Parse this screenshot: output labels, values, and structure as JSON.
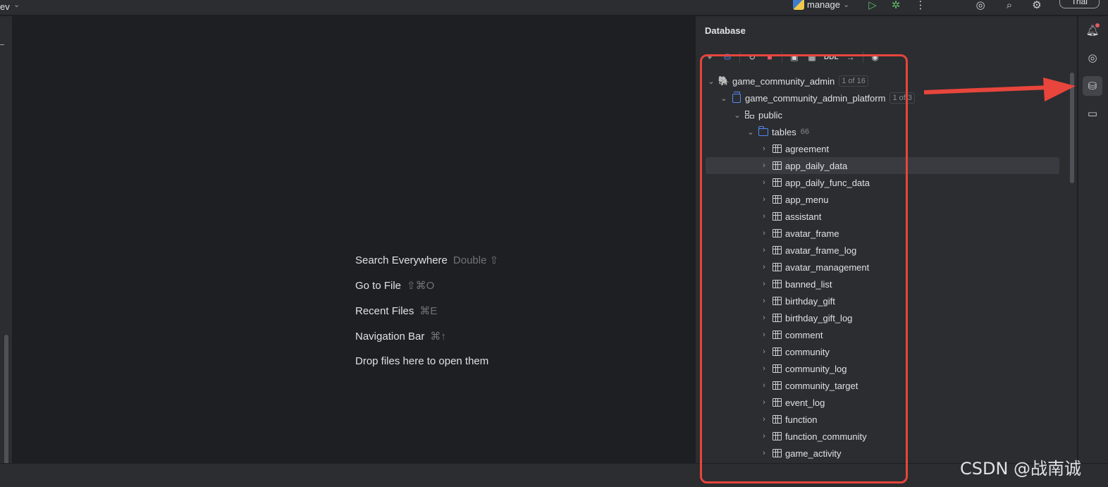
{
  "topbar": {
    "project_fragment": "ev",
    "run_config_label": "manage",
    "trial_label": "Trial",
    "icons": [
      "run-icon",
      "debug-icon",
      "more-icon",
      "ai-assistant-icon",
      "search-icon",
      "settings-icon"
    ]
  },
  "editor": {
    "hints": [
      {
        "label": "Search Everywhere",
        "shortcut": "Double ⇧"
      },
      {
        "label": "Go to File",
        "shortcut": "⇧⌘O"
      },
      {
        "label": "Recent Files",
        "shortcut": "⌘E"
      },
      {
        "label": "Navigation Bar",
        "shortcut": "⌘↑"
      },
      {
        "label": "Drop files here to open them",
        "shortcut": ""
      }
    ]
  },
  "database": {
    "title": "Database",
    "toolbar": {
      "ddl_label": "DDL"
    },
    "tree": {
      "datasource": {
        "name": "game_community_admin",
        "badge": "1 of 16"
      },
      "database": {
        "name": "game_community_admin_platform",
        "badge": "1 of 3"
      },
      "schema": {
        "name": "public"
      },
      "tables_folder": {
        "name": "tables",
        "count": "66"
      },
      "tables": [
        "agreement",
        "app_daily_data",
        "app_daily_func_data",
        "app_menu",
        "assistant",
        "avatar_frame",
        "avatar_frame_log",
        "avatar_management",
        "banned_list",
        "birthday_gift",
        "birthday_gift_log",
        "comment",
        "community",
        "community_log",
        "community_target",
        "event_log",
        "function",
        "function_community",
        "game_activity"
      ],
      "selected_table": "app_daily_data"
    }
  },
  "right_strip": {
    "icons": [
      "notifications-icon",
      "ai-chat-icon",
      "database-icon",
      "services-icon"
    ],
    "active": "database-icon"
  },
  "annotation": {
    "color": "#e8453c"
  },
  "watermark": "CSDN @战南诚"
}
